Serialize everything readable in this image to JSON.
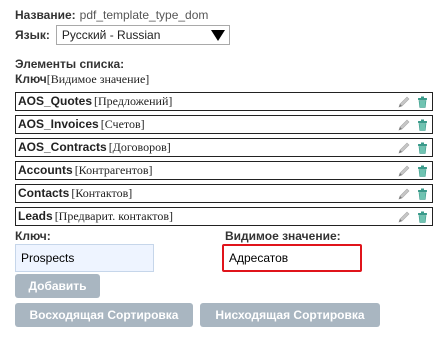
{
  "form": {
    "name_label": "Название:",
    "name_value": "pdf_template_type_dom",
    "language_label": "Язык:",
    "language_value": "Русский - Russian"
  },
  "list": {
    "title": "Элементы списка:",
    "subtitle_key": "Ключ",
    "subtitle_value": "[Видимое значение]",
    "items": [
      {
        "key": "AOS_Quotes",
        "value": "[Предложений]"
      },
      {
        "key": "AOS_Invoices",
        "value": "[Счетов]"
      },
      {
        "key": "AOS_Contracts",
        "value": "[Договоров]"
      },
      {
        "key": "Accounts",
        "value": "[Контрагентов]"
      },
      {
        "key": "Contacts",
        "value": "[Контактов]"
      },
      {
        "key": "Leads",
        "value": "[Предварит. контактов]"
      }
    ]
  },
  "new_item": {
    "key_label": "Ключ:",
    "key_value": "Prospects",
    "value_label": "Видимое значение:",
    "value_value": "Адресатов"
  },
  "buttons": {
    "add": "Добавить",
    "sort_asc": "Восходящая Сортировка",
    "sort_desc": "Нисходящая Сортировка"
  },
  "icons": {
    "edit": "pencil-icon",
    "delete": "trash-icon",
    "dropdown": "triangle-down-icon"
  },
  "colors": {
    "button_bg": "#a9b6c1",
    "highlight_border": "#e0141b",
    "input_key_bg": "#eef4ff",
    "trash_green": "#3a9a8a"
  }
}
